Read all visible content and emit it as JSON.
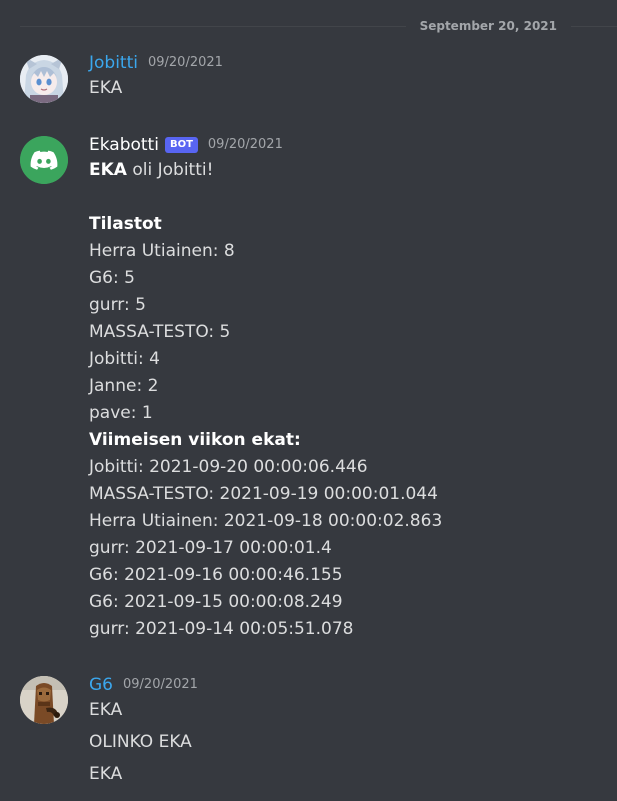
{
  "divider": {
    "date": "September 20, 2021"
  },
  "messages": [
    {
      "username": "Jobitti",
      "username_color": "#3ba7ed",
      "timestamp": "09/20/2021",
      "lines": [
        "EKA"
      ]
    },
    {
      "username": "Ekabotti",
      "username_color": "#ffffff",
      "bot_tag": "BOT",
      "timestamp": "09/20/2021",
      "first_line_bold": "EKA",
      "first_line_rest": " oli Jobitti!",
      "stats_header": "Tilastot",
      "stats": [
        "Herra Utiainen:  8",
        "G6:  5",
        "gurr:  5",
        "MASSA-TESTO:  5",
        "Jobitti:  4",
        "Janne:  2",
        "pave:  1"
      ],
      "week_header": "Viimeisen viikon ekat:",
      "week": [
        "Jobitti:  2021-09-20 00:00:06.446",
        "MASSA-TESTO:  2021-09-19 00:00:01.044",
        "Herra Utiainen:  2021-09-18 00:00:02.863",
        "gurr:  2021-09-17 00:00:01.4",
        "G6:  2021-09-16 00:00:46.155",
        "G6:  2021-09-15 00:00:08.249",
        "gurr:  2021-09-14 00:05:51.078"
      ]
    },
    {
      "username": "G6",
      "username_color": "#3ba7ed",
      "timestamp": "09/20/2021",
      "lines": [
        "EKA",
        "OLINKO EKA",
        "EKA"
      ]
    }
  ],
  "colors": {
    "background": "#36393f",
    "text": "#dcddde",
    "muted": "#a3a6aa",
    "bot_tag": "#5865f2",
    "discord_avatar": "#3ba55d"
  },
  "icons": {
    "jobitti_avatar": "anime-character-avatar",
    "ekabotti_avatar": "discord-logo-icon",
    "g6_avatar": "wooden-figure-avatar"
  }
}
